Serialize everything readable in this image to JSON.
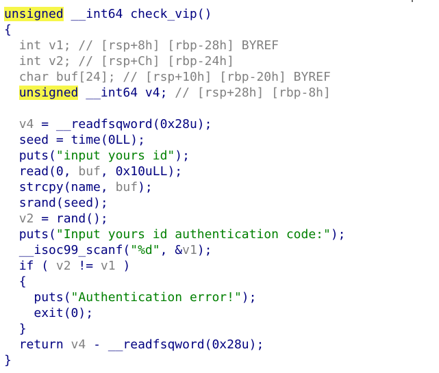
{
  "theme": {
    "background": "#ffffff",
    "default_text": "#000080",
    "string": "#008000",
    "comment_and_variable": "#808080",
    "highlight": "#f6f64a"
  },
  "code": {
    "language": "decompiled C",
    "lines": [
      {
        "indent": "",
        "tokens": [
          {
            "t": "unsigned",
            "c": "keyword",
            "hl": true
          },
          {
            "t": " __int64 check_vip()",
            "c": "plain"
          }
        ]
      },
      {
        "indent": "",
        "tokens": [
          {
            "t": "{",
            "c": "punct"
          }
        ]
      },
      {
        "indent": "  ",
        "tokens": [
          {
            "t": "int v1; ",
            "c": "var"
          },
          {
            "t": "// [rsp+8h] [rbp-28h] BYREF",
            "c": "comment"
          }
        ]
      },
      {
        "indent": "  ",
        "tokens": [
          {
            "t": "int v2; ",
            "c": "var"
          },
          {
            "t": "// [rsp+Ch] [rbp-24h]",
            "c": "comment"
          }
        ]
      },
      {
        "indent": "  ",
        "tokens": [
          {
            "t": "char buf[24]; ",
            "c": "var"
          },
          {
            "t": "// [rsp+10h] [rbp-20h] BYREF",
            "c": "comment"
          }
        ]
      },
      {
        "indent": "  ",
        "tokens": [
          {
            "t": "unsigned",
            "c": "keyword",
            "hl": true
          },
          {
            "t": " __int64 v4; ",
            "c": "plain"
          },
          {
            "t": "// [rsp+28h] [rbp-8h]",
            "c": "comment"
          }
        ]
      },
      {
        "indent": "",
        "tokens": []
      },
      {
        "indent": "  ",
        "tokens": [
          {
            "t": "v4",
            "c": "var"
          },
          {
            "t": " = __readfsqword(0x28u);",
            "c": "plain"
          }
        ]
      },
      {
        "indent": "  ",
        "tokens": [
          {
            "t": "seed = time(0LL);",
            "c": "plain"
          }
        ]
      },
      {
        "indent": "  ",
        "tokens": [
          {
            "t": "puts(",
            "c": "plain"
          },
          {
            "t": "\"input yours id\"",
            "c": "string"
          },
          {
            "t": ");",
            "c": "plain"
          }
        ]
      },
      {
        "indent": "  ",
        "tokens": [
          {
            "t": "read(0, ",
            "c": "plain"
          },
          {
            "t": "buf",
            "c": "var"
          },
          {
            "t": ", 0x10uLL);",
            "c": "plain"
          }
        ]
      },
      {
        "indent": "  ",
        "tokens": [
          {
            "t": "strcpy(name, ",
            "c": "plain"
          },
          {
            "t": "buf",
            "c": "var"
          },
          {
            "t": ");",
            "c": "plain"
          }
        ]
      },
      {
        "indent": "  ",
        "tokens": [
          {
            "t": "srand(seed);",
            "c": "plain"
          }
        ]
      },
      {
        "indent": "  ",
        "tokens": [
          {
            "t": "v2",
            "c": "var"
          },
          {
            "t": " = rand();",
            "c": "plain"
          }
        ]
      },
      {
        "indent": "  ",
        "tokens": [
          {
            "t": "puts(",
            "c": "plain"
          },
          {
            "t": "\"Input yours id authentication code:\"",
            "c": "string"
          },
          {
            "t": ");",
            "c": "plain"
          }
        ]
      },
      {
        "indent": "  ",
        "tokens": [
          {
            "t": "__isoc99_scanf(",
            "c": "plain"
          },
          {
            "t": "\"%d\"",
            "c": "string"
          },
          {
            "t": ", &",
            "c": "plain"
          },
          {
            "t": "v1",
            "c": "var"
          },
          {
            "t": ");",
            "c": "plain"
          }
        ]
      },
      {
        "indent": "  ",
        "tokens": [
          {
            "t": "if ( ",
            "c": "plain"
          },
          {
            "t": "v2",
            "c": "var"
          },
          {
            "t": " != ",
            "c": "plain"
          },
          {
            "t": "v1",
            "c": "var"
          },
          {
            "t": " )",
            "c": "plain"
          }
        ]
      },
      {
        "indent": "  ",
        "tokens": [
          {
            "t": "{",
            "c": "punct"
          }
        ]
      },
      {
        "indent": "    ",
        "tokens": [
          {
            "t": "puts(",
            "c": "plain"
          },
          {
            "t": "\"Authentication error!\"",
            "c": "string"
          },
          {
            "t": ");",
            "c": "plain"
          }
        ]
      },
      {
        "indent": "    ",
        "tokens": [
          {
            "t": "exit(0);",
            "c": "plain"
          }
        ]
      },
      {
        "indent": "  ",
        "tokens": [
          {
            "t": "}",
            "c": "punct"
          }
        ]
      },
      {
        "indent": "  ",
        "tokens": [
          {
            "t": "return ",
            "c": "plain"
          },
          {
            "t": "v4",
            "c": "var"
          },
          {
            "t": " - __readfsqword(0x28u);",
            "c": "plain"
          }
        ]
      },
      {
        "indent": "",
        "tokens": [
          {
            "t": "}",
            "c": "punct"
          }
        ]
      }
    ]
  }
}
